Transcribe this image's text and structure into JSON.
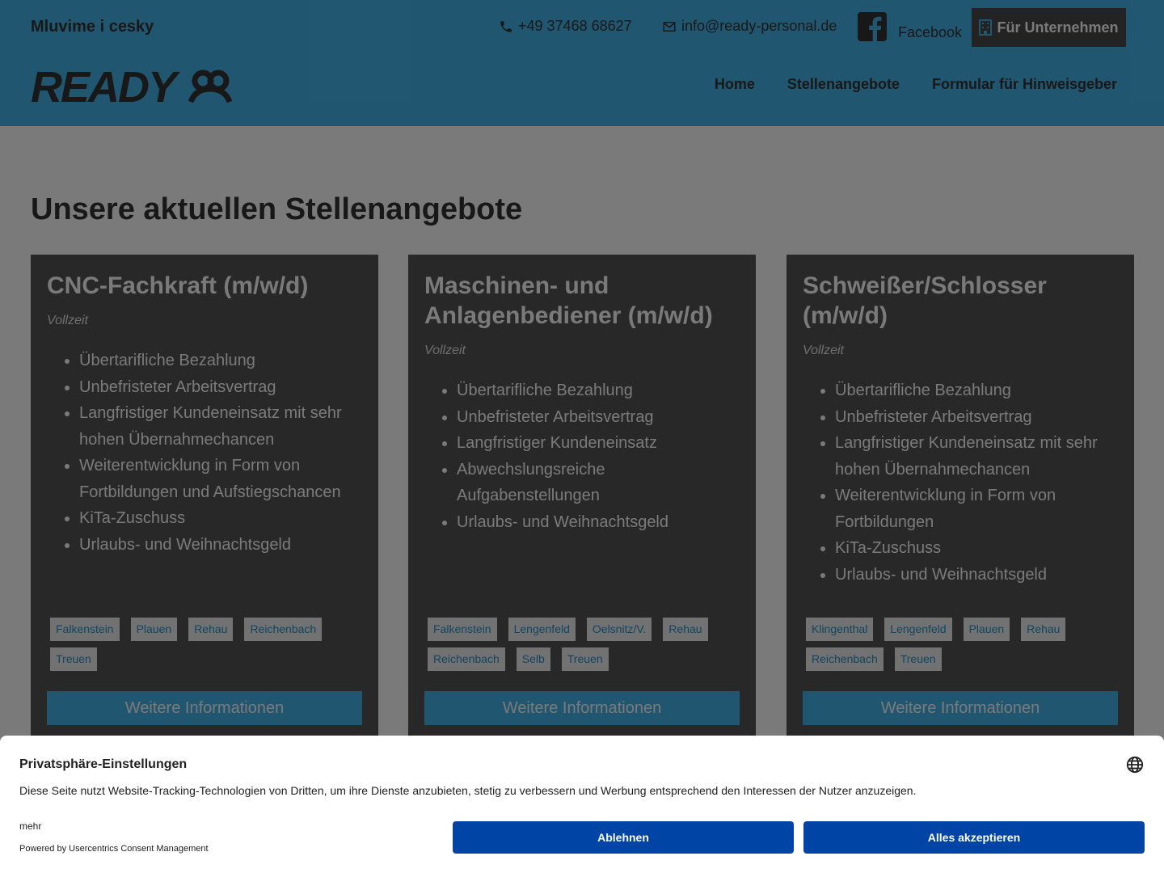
{
  "header": {
    "language_note": "Mluvime i cesky",
    "phone": "+49 37468 68627",
    "email": "info@ready-personal.de",
    "facebook_label": "Facebook",
    "company_button": "Für Unternehmen",
    "logo_text": "READY",
    "nav": [
      "Home",
      "Stellenangebote",
      "Formular für Hinweisgeber"
    ]
  },
  "main": {
    "title": "Unsere aktuellen Stellenangebote",
    "jobs": [
      {
        "title": "CNC-Fachkraft (m/w/d)",
        "type": "Vollzeit",
        "benefits": [
          "Übertarifliche Bezahlung",
          "Unbefristeter Arbeitsvertrag",
          "Langfristiger Kundeneinsatz mit sehr hohen Übernahmechancen",
          "Weiterentwicklung in Form von Fortbildungen und Aufstiegschancen",
          "KiTa-Zuschuss",
          "Urlaubs- und Weihnachtsgeld"
        ],
        "locations": [
          "Falkenstein",
          "Plauen",
          "Rehau",
          "Reichenbach",
          "Treuen"
        ],
        "button": "Weitere Informationen"
      },
      {
        "title": "Maschinen- und Anlagenbediener (m/w/d)",
        "type": "Vollzeit",
        "benefits": [
          "Übertarifliche Bezahlung",
          "Unbefristeter Arbeitsvertrag",
          "Langfristiger Kundeneinsatz",
          "Abwechslungsreiche Aufgabenstellungen",
          "Urlaubs- und Weihnachtsgeld"
        ],
        "locations": [
          "Falkenstein",
          "Lengenfeld",
          "Oelsnitz/V.",
          "Rehau",
          "Reichenbach",
          "Selb",
          "Treuen"
        ],
        "button": "Weitere Informationen"
      },
      {
        "title": "Schweißer/Schlosser (m/w/d)",
        "type": "Vollzeit",
        "benefits": [
          "Übertarifliche Bezahlung",
          "Unbefristeter Arbeitsvertrag",
          "Langfristiger Kundeneinsatz mit sehr hohen Übernahmechancen",
          "Weiterentwicklung in Form von Fortbildungen",
          "KiTa-Zuschuss",
          "Urlaubs- und Weihnachtsgeld"
        ],
        "locations": [
          "Klingenthal",
          "Lengenfeld",
          "Plauen",
          "Rehau",
          "Reichenbach",
          "Treuen"
        ],
        "button": "Weitere Informationen"
      }
    ]
  },
  "consent": {
    "title": "Privatsphäre-Einstellungen",
    "text": "Diese Seite nutzt Website-Tracking-Technologien von Dritten, um ihre Dienste anzubieten, stetig zu verbessern und Werbung entsprechend den Interessen der Nutzer anzuzeigen.",
    "more": "mehr",
    "powered": "Powered by Usercentrics Consent Management",
    "deny": "Ablehnen",
    "accept": "Alles akzeptieren"
  },
  "colors": {
    "brand_blue": "#46b5eb",
    "card_bg": "#555555",
    "consent_button": "#0045a5"
  },
  "icons": [
    "phone-icon",
    "mail-icon",
    "facebook-icon",
    "building-icon",
    "globe-icon"
  ]
}
